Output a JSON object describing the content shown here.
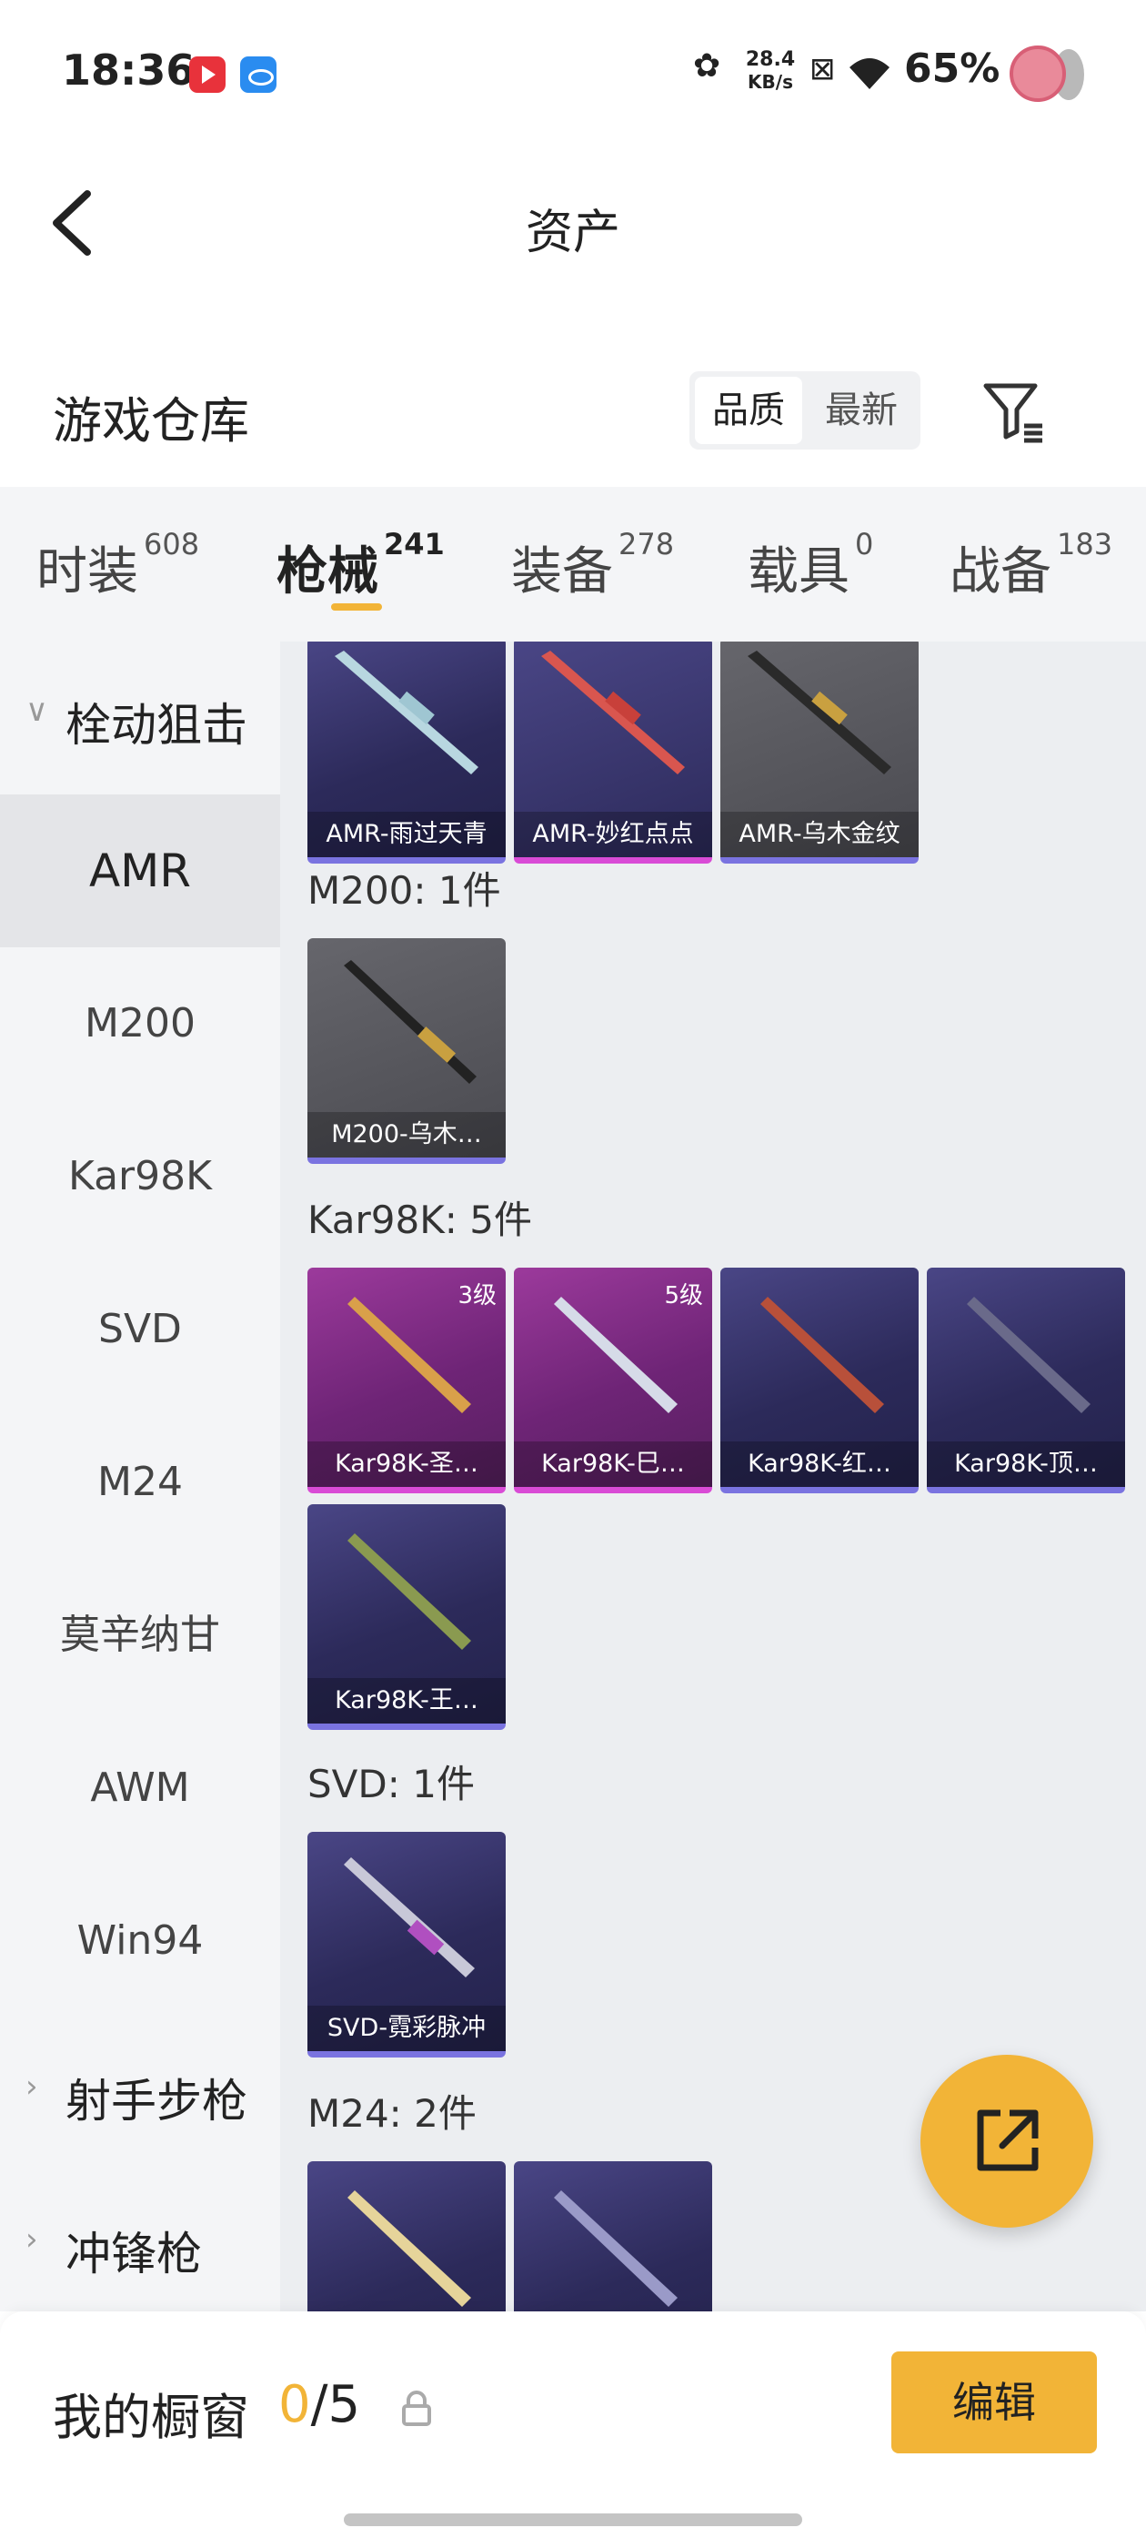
{
  "status_bar": {
    "time": "18:36",
    "speed_value": "28.4",
    "speed_unit": "KB/s",
    "battery": "65%"
  },
  "header": {
    "title": "资产"
  },
  "warehouse": {
    "title": "游戏仓库",
    "sort_quality": "品质",
    "sort_latest": "最新"
  },
  "tabs": [
    {
      "label": "时装",
      "count": "608"
    },
    {
      "label": "枪械",
      "count": "241"
    },
    {
      "label": "装备",
      "count": "278"
    },
    {
      "label": "载具",
      "count": "0"
    },
    {
      "label": "战备",
      "count": "183"
    }
  ],
  "sidebar": {
    "groups": {
      "bolt": "栓动狙击",
      "marksman": "射手步枪",
      "smg": "冲锋枪"
    },
    "items": [
      "AMR",
      "M200",
      "Kar98K",
      "SVD",
      "M24",
      "莫辛纳甘",
      "AWM",
      "Win94"
    ]
  },
  "content": {
    "amr_cards": [
      "AMR-雨过天青",
      "AMR-妙红点点",
      "AMR-乌木金纹"
    ],
    "m200_title": "M200: 1件",
    "m200_cards": [
      "M200-乌木…"
    ],
    "kar_title": "Kar98K: 5件",
    "kar_cards": [
      "Kar98K-圣…",
      "Kar98K-巳…",
      "Kar98K-红…",
      "Kar98K-顶…",
      "Kar98K-王…"
    ],
    "kar_levels": [
      "3级",
      "5级"
    ],
    "svd_title": "SVD: 1件",
    "svd_cards": [
      "SVD-霓彩脉冲"
    ],
    "m24_title": "M24: 2件"
  },
  "bottom": {
    "title": "我的橱窗",
    "count_current": "0",
    "count_total": "/5",
    "edit_label": "编辑"
  },
  "colors": {
    "accent": "#f2b437",
    "card_purple": "#2c2a5a",
    "card_pink": "#6e2476",
    "card_gray": "#4a4a50"
  }
}
